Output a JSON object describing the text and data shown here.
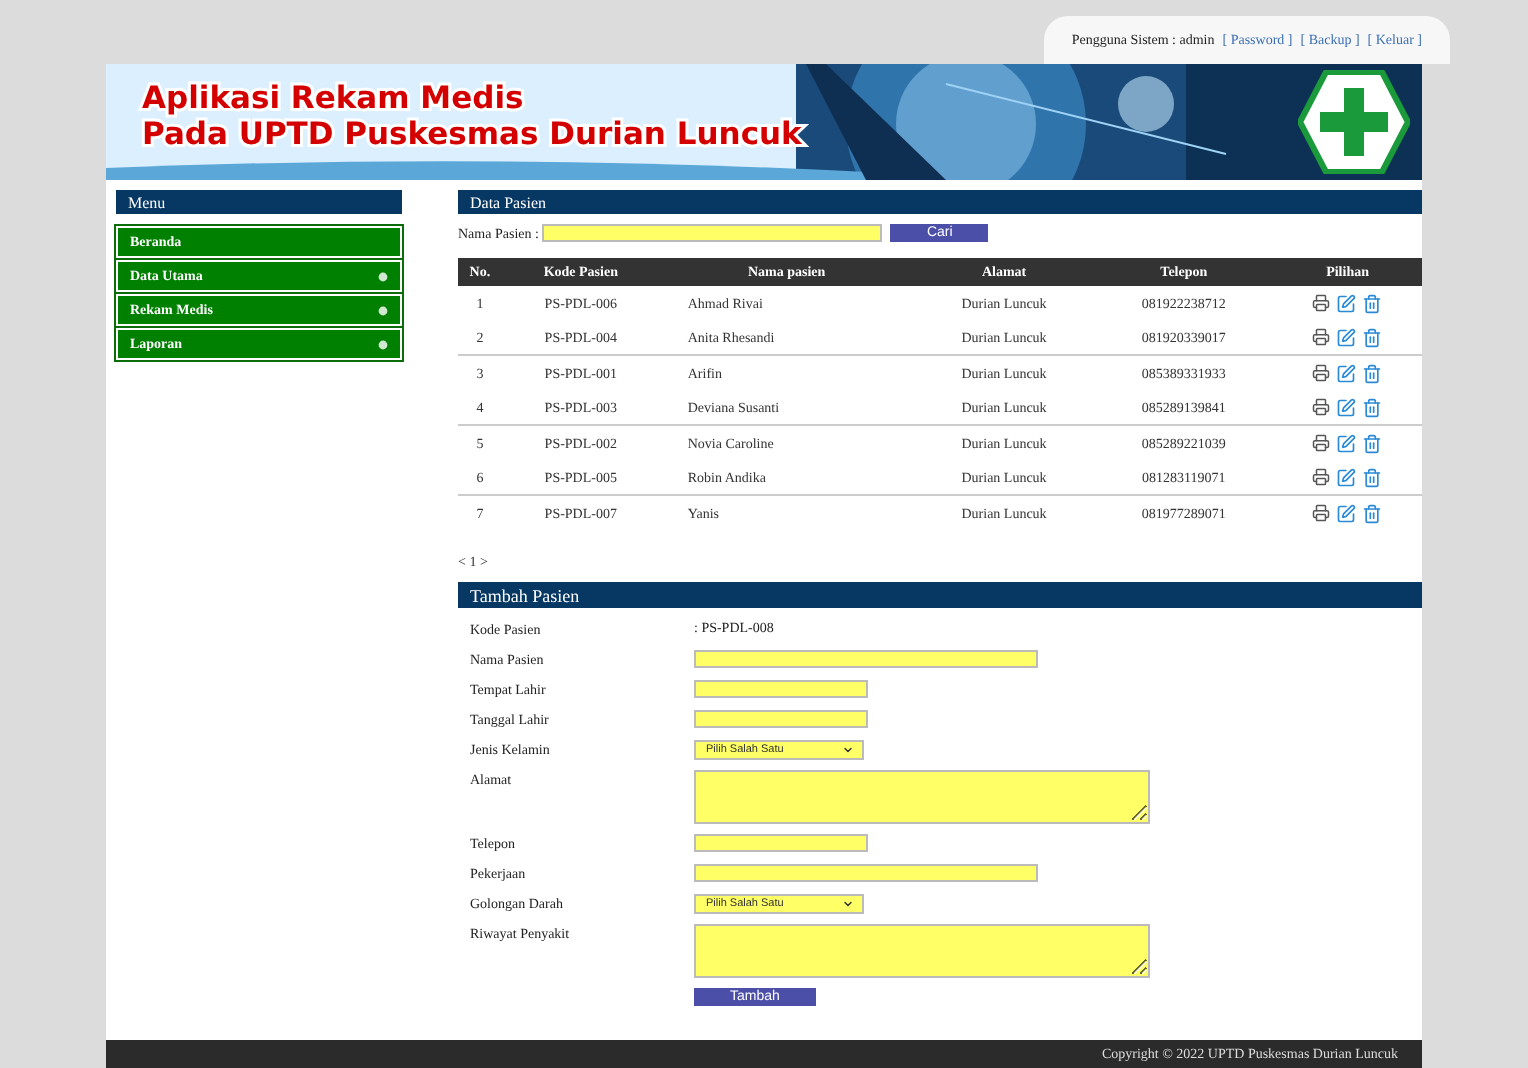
{
  "user_bar": {
    "text": "Pengguna Sistem : admin",
    "links": [
      "[ Password ]",
      "[ Backup ]",
      "[ Keluar ]"
    ]
  },
  "banner": {
    "title_lines": [
      "Aplikasi Rekam Medis",
      "Pada UPTD Puskesmas Durian Luncuk"
    ]
  },
  "sidebar": {
    "title": "Menu",
    "items": [
      {
        "label": "Beranda",
        "has_submenu": false
      },
      {
        "label": "Data Utama",
        "has_submenu": true
      },
      {
        "label": "Rekam Medis",
        "has_submenu": true
      },
      {
        "label": "Laporan",
        "has_submenu": true
      }
    ]
  },
  "patients": {
    "title": "Data Pasien",
    "search": {
      "label": "Nama Pasien :",
      "button": "Cari"
    },
    "columns": [
      "No.",
      "Kode Pasien",
      "Nama pasien",
      "Alamat",
      "Telepon",
      "Pilihan"
    ],
    "rows": [
      {
        "no": "1",
        "code": "PS-PDL-006",
        "name": "Ahmad Rivai",
        "address": "Durian Luncuk",
        "phone": "081922238712"
      },
      {
        "no": "2",
        "code": "PS-PDL-004",
        "name": "Anita Rhesandi",
        "address": "Durian Luncuk",
        "phone": "081920339017"
      },
      {
        "no": "3",
        "code": "PS-PDL-001",
        "name": "Arifin",
        "address": "Durian Luncuk",
        "phone": "085389331933"
      },
      {
        "no": "4",
        "code": "PS-PDL-003",
        "name": "Deviana Susanti",
        "address": "Durian Luncuk",
        "phone": "085289139841"
      },
      {
        "no": "5",
        "code": "PS-PDL-002",
        "name": "Novia Caroline",
        "address": "Durian Luncuk",
        "phone": "085289221039"
      },
      {
        "no": "6",
        "code": "PS-PDL-005",
        "name": "Robin Andika",
        "address": "Durian Luncuk",
        "phone": "081283119071"
      },
      {
        "no": "7",
        "code": "PS-PDL-007",
        "name": "Yanis",
        "address": "Durian Luncuk",
        "phone": "081977289071"
      }
    ],
    "pagination": "< 1 >"
  },
  "form": {
    "title": "Tambah Pasien",
    "fields": [
      {
        "kind": "static",
        "label": "Kode Pasien",
        "value": ": PS-PDL-008"
      },
      {
        "kind": "wide",
        "label": "Nama Pasien"
      },
      {
        "kind": "narrow",
        "label": "Tempat Lahir"
      },
      {
        "kind": "narrow",
        "label": "Tanggal Lahir"
      },
      {
        "kind": "select",
        "label": "Jenis Kelamin",
        "value": "Pilih Salah Satu"
      },
      {
        "kind": "textarea",
        "label": "Alamat"
      },
      {
        "kind": "narrow",
        "label": "Telepon"
      },
      {
        "kind": "wide",
        "label": "Pekerjaan"
      },
      {
        "kind": "select",
        "label": "Golongan Darah",
        "value": "Pilih Salah Satu"
      },
      {
        "kind": "textarea",
        "label": "Riwayat Penyakit"
      }
    ],
    "submit": "Tambah"
  },
  "footer": "Copyright © 2022 UPTD Puskesmas Durian Luncuk"
}
